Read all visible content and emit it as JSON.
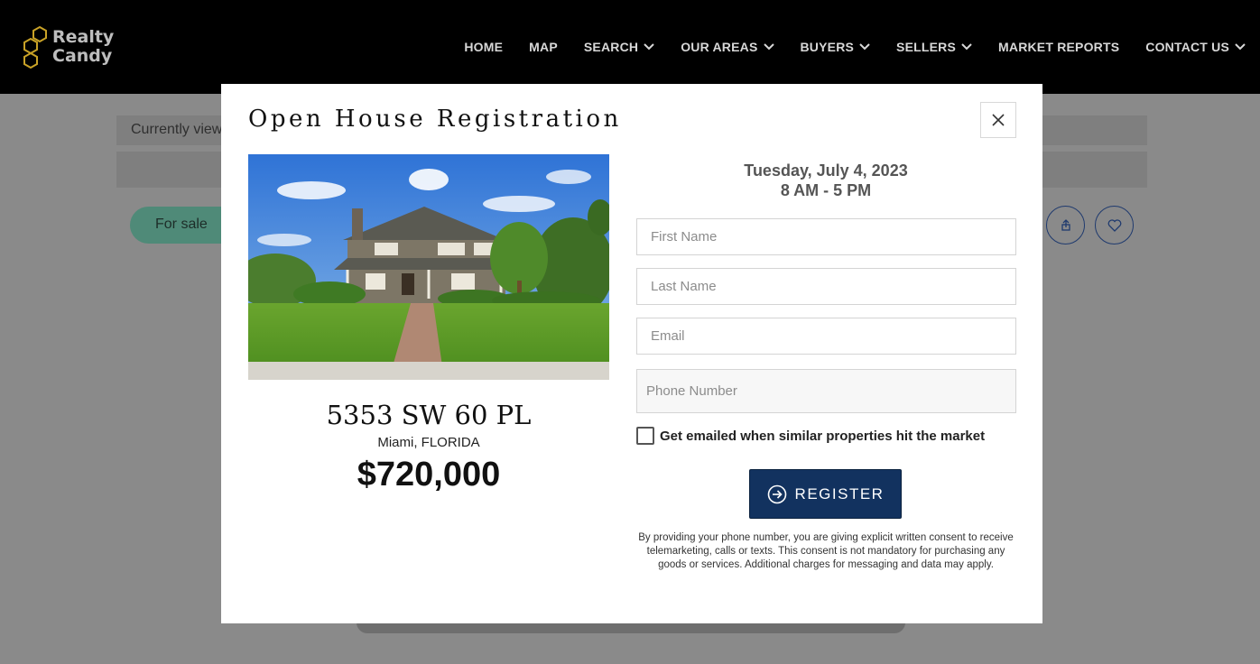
{
  "header": {
    "logo_line1": "Realty",
    "logo_line2": "Candy",
    "nav": [
      {
        "label": "HOME",
        "dropdown": false
      },
      {
        "label": "MAP",
        "dropdown": false
      },
      {
        "label": "SEARCH",
        "dropdown": true
      },
      {
        "label": "OUR AREAS",
        "dropdown": true
      },
      {
        "label": "BUYERS",
        "dropdown": true
      },
      {
        "label": "SELLERS",
        "dropdown": true
      },
      {
        "label": "MARKET REPORTS",
        "dropdown": false
      },
      {
        "label": "CONTACT US",
        "dropdown": true
      }
    ]
  },
  "background": {
    "currently_viewing": "Currently view",
    "status_pill": "For sale"
  },
  "modal": {
    "title": "Open House Registration",
    "close_icon": "close-icon",
    "property": {
      "address": "5353 SW 60 PL",
      "city": "Miami, FLORIDA",
      "price": "$720,000"
    },
    "event": {
      "date": "Tuesday, July 4, 2023",
      "time": "8 AM - 5 PM"
    },
    "form": {
      "first_name_placeholder": "First Name",
      "last_name_placeholder": "Last Name",
      "email_placeholder": "Email",
      "phone_placeholder": "Phone Number",
      "checkbox_label": "Get emailed when similar properties hit the market",
      "checkbox_checked": false,
      "register_label": "REGISTER"
    },
    "disclaimer": "By providing your phone number, you are giving explicit written consent to receive telemarketing, calls or texts. This consent is not mandatory for purchasing any goods or services. Additional charges for messaging and data may apply."
  },
  "colors": {
    "header_bg": "#000000",
    "overlay_bg": "#8a8a8a",
    "register_button": "#12325f",
    "logo_accent": "#c9a227"
  }
}
